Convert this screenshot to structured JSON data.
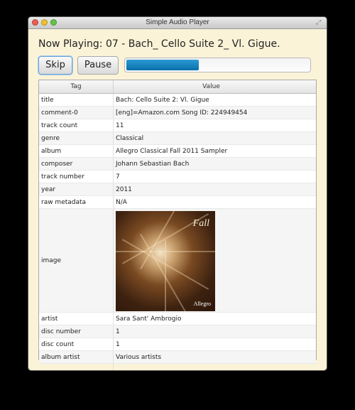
{
  "window": {
    "title": "Simple Audio Player"
  },
  "player": {
    "now_playing": "Now Playing: 07 - Bach_ Cello Suite 2_ Vl. Gigue.",
    "skip_label": "Skip",
    "pause_label": "Pause",
    "progress": 0.4,
    "progress_color": "#1383c1"
  },
  "table": {
    "headers": {
      "tag": "Tag",
      "value": "Value"
    },
    "rows": [
      {
        "tag": "title",
        "value": "Bach: Cello Suite 2: Vl. Gigue"
      },
      {
        "tag": "comment-0",
        "value": "[eng]=Amazon.com Song ID: 224949454"
      },
      {
        "tag": "track count",
        "value": "11"
      },
      {
        "tag": "genre",
        "value": "Classical"
      },
      {
        "tag": "album",
        "value": "Allegro Classical Fall 2011 Sampler"
      },
      {
        "tag": "composer",
        "value": "Johann Sebastian Bach"
      },
      {
        "tag": "track number",
        "value": "7"
      },
      {
        "tag": "year",
        "value": "2011"
      },
      {
        "tag": "raw metadata",
        "value": "N/A"
      },
      {
        "tag": "image",
        "value": ""
      },
      {
        "tag": "artist",
        "value": "Sara Sant' Ambrogio"
      },
      {
        "tag": "disc number",
        "value": "1"
      },
      {
        "tag": "disc count",
        "value": "1"
      },
      {
        "tag": "album artist",
        "value": "Various artists"
      }
    ],
    "album_art": {
      "title": "Fall",
      "label": "Allegro"
    }
  }
}
